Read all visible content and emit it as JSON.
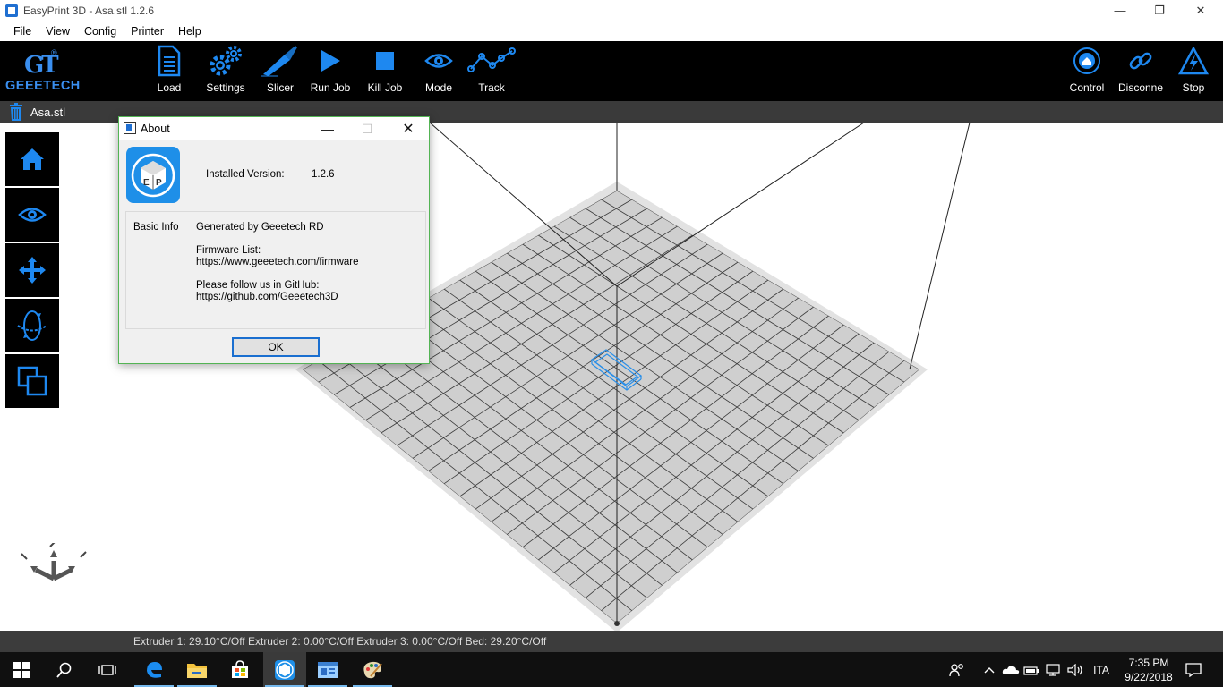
{
  "window": {
    "title": "EasyPrint 3D - Asa.stl   1.2.6",
    "minimize": "—",
    "maximize": "❐",
    "close": "✕"
  },
  "menu": [
    "File",
    "View",
    "Config",
    "Printer",
    "Help"
  ],
  "logo": {
    "mark": "GT",
    "registered": "®",
    "name": "GEEETECH"
  },
  "toolbar": {
    "left": [
      {
        "label": "Load",
        "icon": "document-icon"
      },
      {
        "label": "Settings",
        "icon": "gears-icon"
      },
      {
        "label": "Slicer",
        "icon": "knife-icon"
      },
      {
        "label": "Run Job",
        "icon": "play-icon"
      },
      {
        "label": "Kill Job",
        "icon": "stop-square-icon"
      },
      {
        "label": "Mode",
        "icon": "eye-icon"
      },
      {
        "label": "Track",
        "icon": "track-line-icon"
      }
    ],
    "right": [
      {
        "label": "Control",
        "icon": "home-circle-icon"
      },
      {
        "label": "Disconne",
        "icon": "link-icon"
      },
      {
        "label": "Stop",
        "icon": "lightning-triangle-icon"
      }
    ]
  },
  "tab": {
    "label": "Asa.stl"
  },
  "sidetools": [
    "home-view-icon",
    "view-eye-icon",
    "move-arrows-icon",
    "rotate-icon",
    "scale-icon"
  ],
  "status": {
    "text": "Extruder 1: 29.10°C/Off Extruder 2: 0.00°C/Off Extruder 3: 0.00°C/Off Bed: 29.20°C/Off"
  },
  "dialog": {
    "title": "About",
    "version_label": "Installed Version:",
    "version_value": "1.2.6",
    "basic_info_label": "Basic Info",
    "generated_by": "Generated by Geeetech RD",
    "firmware_label": "Firmware List:",
    "firmware_url": "https://www.geeetech.com/firmware",
    "github_label": "Please follow us in GitHub:",
    "github_url": "https://github.com/Geeetech3D",
    "ok_label": "OK",
    "logo_letters": "EP"
  },
  "taskbar": {
    "clock_time": "7:35 PM",
    "clock_date": "9/22/2018",
    "language": "ITA"
  },
  "colors": {
    "accent_blue": "#1e88f0",
    "toolbar_bg": "#000000",
    "dialog_border": "#53b454",
    "model_outline": "#2a8fe8"
  }
}
